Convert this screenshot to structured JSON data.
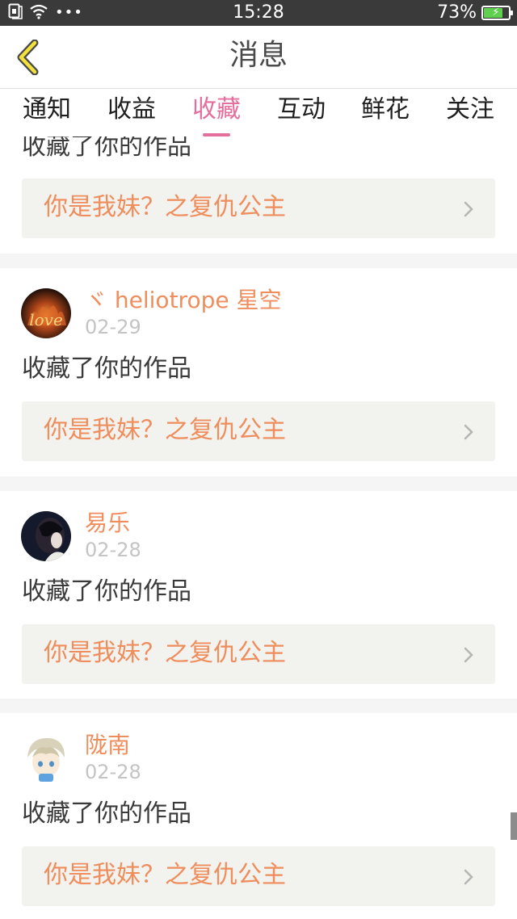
{
  "status_bar": {
    "time": "15:28",
    "battery_percent": "73%",
    "battery_level": 0.73,
    "icons": [
      "sim-icon",
      "wifi-icon",
      "more-dots-icon",
      "battery-charging-icon"
    ]
  },
  "header": {
    "title": "消息",
    "back_icon": "chevron-left-icon"
  },
  "tabs": [
    {
      "label": "通知",
      "active": false
    },
    {
      "label": "收益",
      "active": false
    },
    {
      "label": "收藏",
      "active": true
    },
    {
      "label": "互动",
      "active": false
    },
    {
      "label": "鲜花",
      "active": false
    },
    {
      "label": "关注",
      "active": false
    }
  ],
  "colors": {
    "accent_pink": "#e46f9c",
    "accent_orange": "#ef8d5c",
    "status_bar": "#3a3a3a",
    "work_box_bg": "#f2f2ee"
  },
  "messages": [
    {
      "partial": true,
      "action": "收藏了你的作品",
      "work_title": "你是我妹？之复仇公主"
    },
    {
      "user": "ヾ heliotrope 星空",
      "date": "02-29",
      "avatar": "fire-love-avatar",
      "action": "收藏了你的作品",
      "work_title": "你是我妹？之复仇公主"
    },
    {
      "user": "易乐",
      "date": "02-28",
      "avatar": "dark-portrait-avatar",
      "action": "收藏了你的作品",
      "work_title": "你是我妹？之复仇公主"
    },
    {
      "user": "陇南",
      "date": "02-28",
      "avatar": "anime-boy-avatar",
      "action": "收藏了你的作品",
      "work_title": "你是我妹？之复仇公主"
    }
  ]
}
